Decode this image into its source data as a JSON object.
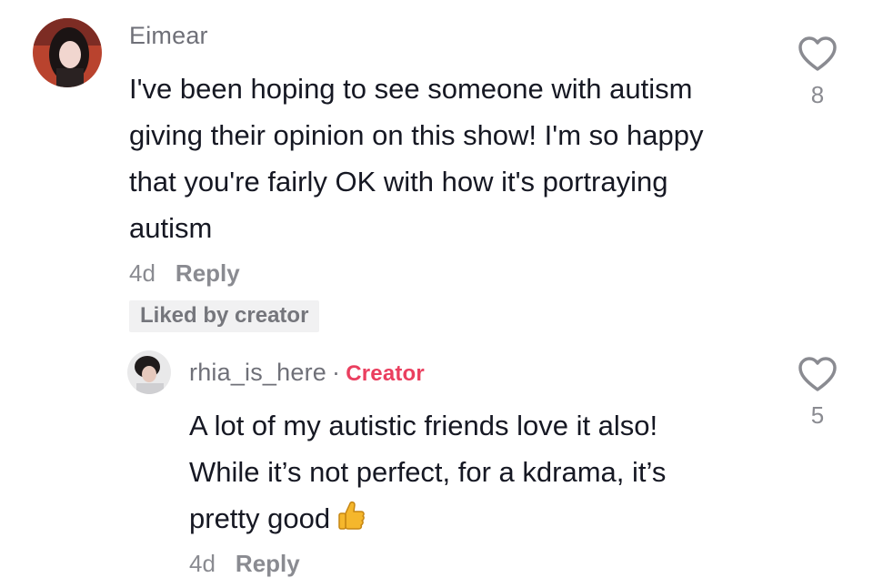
{
  "comment": {
    "username": "Eimear",
    "text_lines": [
      "I've been hoping to see someone with autism",
      "giving their opinion on this show! I'm so happy",
      "that you're fairly OK with how it's portraying",
      "autism"
    ],
    "time": "4d",
    "reply_label": "Reply",
    "badge": "Liked by creator",
    "like_count": "8"
  },
  "reply": {
    "username": "rhia_is_here",
    "separator": "·",
    "creator_label": "Creator",
    "text_lines": [
      "A lot of my autistic friends love it also!",
      "While it’s not perfect, for a kdrama, it’s",
      "pretty good"
    ],
    "emoji": "thumbs-up-icon",
    "time": "4d",
    "reply_label": "Reply",
    "like_count": "5"
  },
  "colors": {
    "creator": "#ea3f5f",
    "secondary_text": "#8a8b91",
    "badge_bg": "#f1f1f2"
  }
}
